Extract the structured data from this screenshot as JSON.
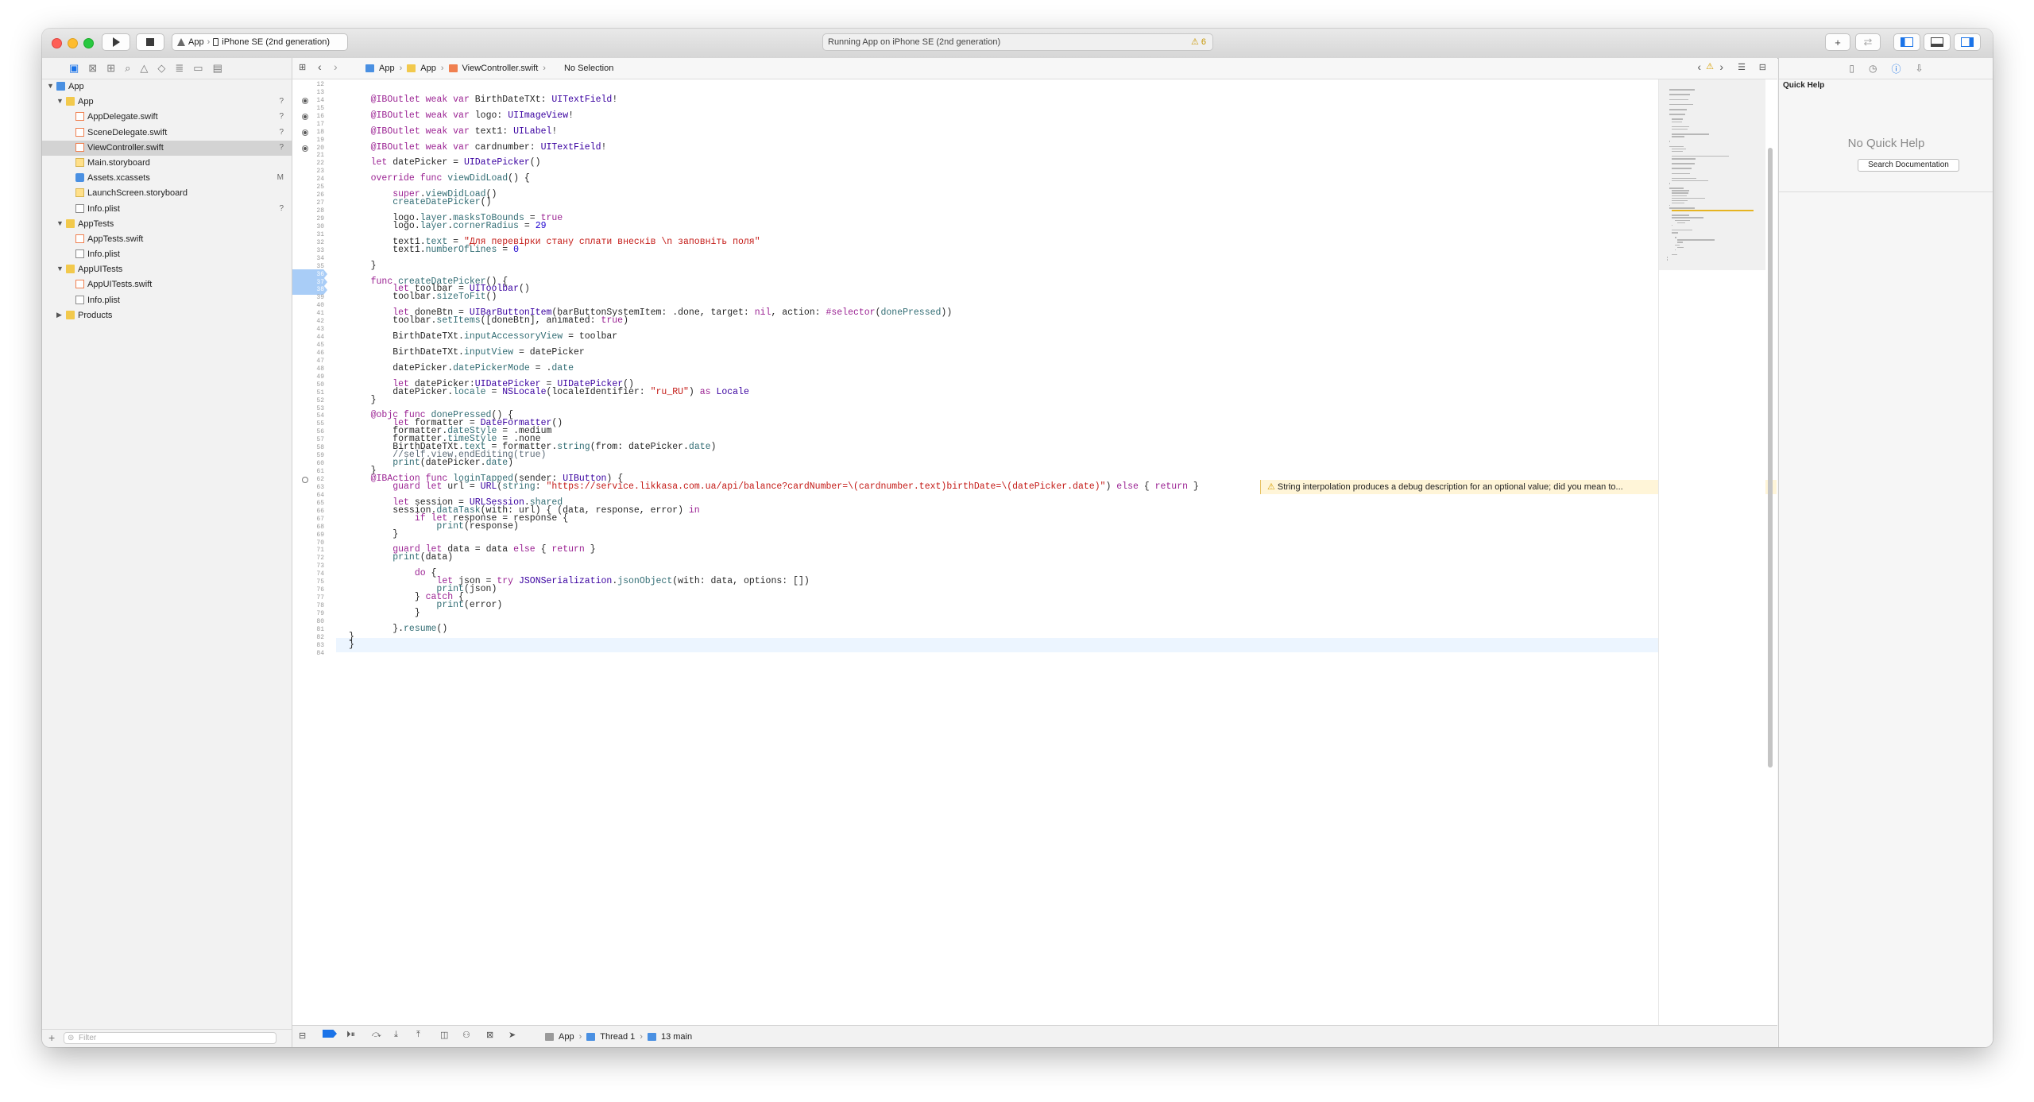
{
  "toolbar": {
    "scheme_target": "App",
    "scheme_device": "iPhone SE (2nd generation)",
    "activity_text": "Running App on iPhone SE (2nd generation)",
    "warning_count": "6"
  },
  "navigator": {
    "filter_placeholder": "Filter",
    "items": [
      {
        "label": "App",
        "depth": 0,
        "kind": "proj",
        "expanded": true,
        "badge": ""
      },
      {
        "label": "App",
        "depth": 1,
        "kind": "folder",
        "expanded": true,
        "badge": "?"
      },
      {
        "label": "AppDelegate.swift",
        "depth": 2,
        "kind": "swift",
        "badge": "?"
      },
      {
        "label": "SceneDelegate.swift",
        "depth": 2,
        "kind": "swift",
        "badge": "?"
      },
      {
        "label": "ViewController.swift",
        "depth": 2,
        "kind": "swift",
        "badge": "?",
        "selected": true
      },
      {
        "label": "Main.storyboard",
        "depth": 2,
        "kind": "sb",
        "badge": ""
      },
      {
        "label": "Assets.xcassets",
        "depth": 2,
        "kind": "xc",
        "badge": "M"
      },
      {
        "label": "LaunchScreen.storyboard",
        "depth": 2,
        "kind": "sb",
        "badge": ""
      },
      {
        "label": "Info.plist",
        "depth": 2,
        "kind": "plist",
        "badge": "?"
      },
      {
        "label": "AppTests",
        "depth": 1,
        "kind": "folder",
        "expanded": true,
        "badge": ""
      },
      {
        "label": "AppTests.swift",
        "depth": 2,
        "kind": "swift",
        "badge": ""
      },
      {
        "label": "Info.plist",
        "depth": 2,
        "kind": "plist",
        "badge": ""
      },
      {
        "label": "AppUITests",
        "depth": 1,
        "kind": "folder",
        "expanded": true,
        "badge": ""
      },
      {
        "label": "AppUITests.swift",
        "depth": 2,
        "kind": "swift",
        "badge": ""
      },
      {
        "label": "Info.plist",
        "depth": 2,
        "kind": "plist",
        "badge": ""
      },
      {
        "label": "Products",
        "depth": 1,
        "kind": "folder",
        "expanded": false,
        "badge": ""
      }
    ]
  },
  "jumpbar": {
    "crumbs": [
      "App",
      "App",
      "ViewController.swift",
      "No Selection"
    ]
  },
  "editor": {
    "first_line_number": 12,
    "current_line": 83,
    "breakpoint_lines": [
      36,
      37,
      38
    ],
    "outlet_lines": [
      14,
      16,
      18,
      20
    ],
    "action_line": 62,
    "warning": {
      "line": 63,
      "text": "String interpolation produces a debug description for an optional value; did you mean to..."
    },
    "lines": [
      "",
      "",
      "    @IBOutlet weak var BirthDateTXt: UITextField!",
      "",
      "    @IBOutlet weak var logo: UIImageView!",
      "",
      "    @IBOutlet weak var text1: UILabel!",
      "",
      "    @IBOutlet weak var cardnumber: UITextField!",
      "",
      "    let datePicker = UIDatePicker()",
      "",
      "    override func viewDidLoad() {",
      "",
      "        super.viewDidLoad()",
      "        createDatePicker()",
      "",
      "        logo.layer.masksToBounds = true",
      "        logo.layer.cornerRadius = 29",
      "",
      "        text1.text = \"Для перевірки стану сплати внесків \\n заповніть поля\"",
      "        text1.numberOfLines = 0",
      "",
      "    }",
      "",
      "    func createDatePicker() {",
      "        let toolbar = UIToolbar()",
      "        toolbar.sizeToFit()",
      "",
      "        let doneBtn = UIBarButtonItem(barButtonSystemItem: .done, target: nil, action: #selector(donePressed))",
      "        toolbar.setItems([doneBtn], animated: true)",
      "",
      "        BirthDateTXt.inputAccessoryView = toolbar",
      "",
      "        BirthDateTXt.inputView = datePicker",
      "",
      "        datePicker.datePickerMode = .date",
      "",
      "        let datePicker:UIDatePicker = UIDatePicker()",
      "        datePicker.locale = NSLocale(localeIdentifier: \"ru_RU\") as Locale",
      "    }",
      "",
      "    @objc func donePressed() {",
      "        let formatter = DateFormatter()",
      "        formatter.dateStyle = .medium",
      "        formatter.timeStyle = .none",
      "        BirthDateTXt.text = formatter.string(from: datePicker.date)",
      "        //self.view.endEditing(true)",
      "        print(datePicker.date)",
      "    }",
      "    @IBAction func loginTapped(sender: UIButton) {",
      "        guard let url = URL(string: \"https://service.likkasa.com.ua/api/balance?cardNumber=\\(cardnumber.text)birthDate=\\(datePicker.date)\") else { return }",
      "",
      "        let session = URLSession.shared",
      "        session.dataTask(with: url) { (data, response, error) in",
      "            if let response = response {",
      "                print(response)",
      "        }",
      "",
      "        guard let data = data else { return }",
      "        print(data)",
      "",
      "            do {",
      "                let json = try JSONSerialization.jsonObject(with: data, options: [])",
      "                print(json)",
      "            } catch {",
      "                print(error)",
      "            }",
      "",
      "        }.resume()",
      "}",
      "}",
      ""
    ]
  },
  "debugbar": {
    "crumbs": [
      "App",
      "Thread 1",
      "13 main"
    ]
  },
  "inspector": {
    "title": "Quick Help",
    "empty_text": "No Quick Help",
    "search_button": "Search Documentation"
  },
  "colors": {
    "keyword": "#9b2393",
    "type": "#3900a0",
    "function": "#326d74",
    "string": "#c41a16",
    "breakpoint": "#a9cdf7",
    "accent": "#1a73e8"
  }
}
